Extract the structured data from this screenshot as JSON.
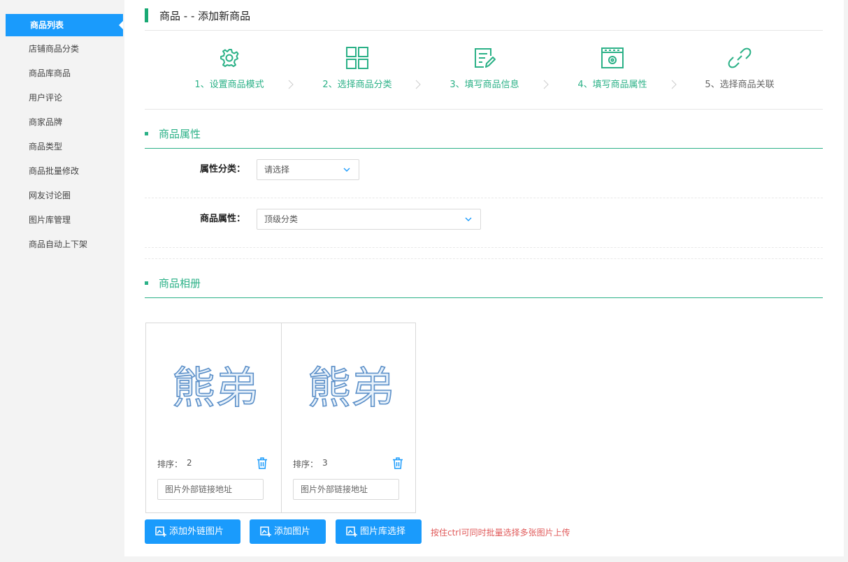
{
  "sidebar": {
    "active": "商品列表",
    "items": [
      "店铺商品分类",
      "商品库商品",
      "用户评论",
      "商家品牌",
      "商品类型",
      "商品批量修改",
      "网友讨论圈",
      "图片库管理",
      "商品自动上下架"
    ]
  },
  "page_title": "商品 - - 添加新商品",
  "steps": [
    {
      "label": "1、设置商品模式",
      "icon": "settings-gear-icon",
      "state": "done"
    },
    {
      "label": "2、选择商品分类",
      "icon": "grid-icon",
      "state": "done"
    },
    {
      "label": "3、填写商品信息",
      "icon": "edit-document-icon",
      "state": "done"
    },
    {
      "label": "4、填写商品属性",
      "icon": "window-settings-icon",
      "state": "active"
    },
    {
      "label": "5、选择商品关联",
      "icon": "link-icon",
      "state": "pending"
    }
  ],
  "attributes": {
    "section_title": "商品属性",
    "category_label": "属性分类：",
    "category_value": "请选择",
    "goods_attr_label": "商品属性：",
    "goods_attr_value": "顶级分类"
  },
  "album": {
    "section_title": "商品相册",
    "images": [
      {
        "sort_label": "排序：",
        "sort": "2",
        "link_placeholder": "图片外部链接地址",
        "watermark": "熊弟"
      },
      {
        "sort_label": "排序：",
        "sort": "3",
        "link_placeholder": "图片外部链接地址",
        "watermark": "熊弟"
      }
    ],
    "buttons": [
      "添加外链图片",
      "添加图片",
      "图片库选择"
    ],
    "hint": "按住ctrl可同时批量选择多张图片上传"
  },
  "colors": {
    "accent_blue": "#1a9bfc",
    "accent_green": "#2bb187",
    "hint_red": "#e05a5a"
  }
}
